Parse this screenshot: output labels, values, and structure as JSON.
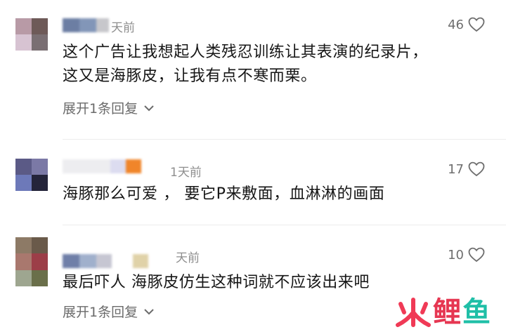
{
  "comments": [
    {
      "time": "天前",
      "likes": "46",
      "lines": [
        "这个广告让我想起人类残忍训练让其表演的纪录片，",
        "这又是海豚皮，让我有点不寒而栗。"
      ],
      "expand": "展开1条回复",
      "avatar_colors": [
        "#b89aa6",
        "#6e5a58",
        "#d7c3d2",
        "#7a6f73"
      ],
      "name_colors": [
        "#6c7ea3",
        "#8296b8",
        "#c7c7cb"
      ]
    },
    {
      "time": "1天前",
      "likes": "17",
      "lines": [
        "海豚那么可爱 ， 要它P来敷面，血淋淋的画面"
      ],
      "expand": "",
      "avatar_colors": [
        "#5b5a86",
        "#7b79a6",
        "#6d79b9",
        "#24243a"
      ],
      "name_colors": [
        "#e6e6ea",
        "#dcdcf0",
        "#f0852a"
      ]
    },
    {
      "time": "天前",
      "likes": "10",
      "lines": [
        "最后吓人 海豚皮仿生这种词就不应该出来吧"
      ],
      "expand": "展开1条回复",
      "avatar_colors": [
        "#8d7a66",
        "#a9786e",
        "#9ea690",
        "#6a6f4a"
      ],
      "name_colors": [
        "#6f7fa8",
        "#a0b0cc",
        "#e0d2a8"
      ]
    }
  ],
  "watermark": {
    "icon": "fire-icon",
    "char1": "鲤",
    "char2": "鱼",
    "colors": {
      "fire": "#f03a56",
      "li": "#e63752",
      "yu": "#1fbfa7"
    }
  },
  "icons": {
    "like": "heart-outline-icon",
    "expand": "chevron-down-icon"
  }
}
